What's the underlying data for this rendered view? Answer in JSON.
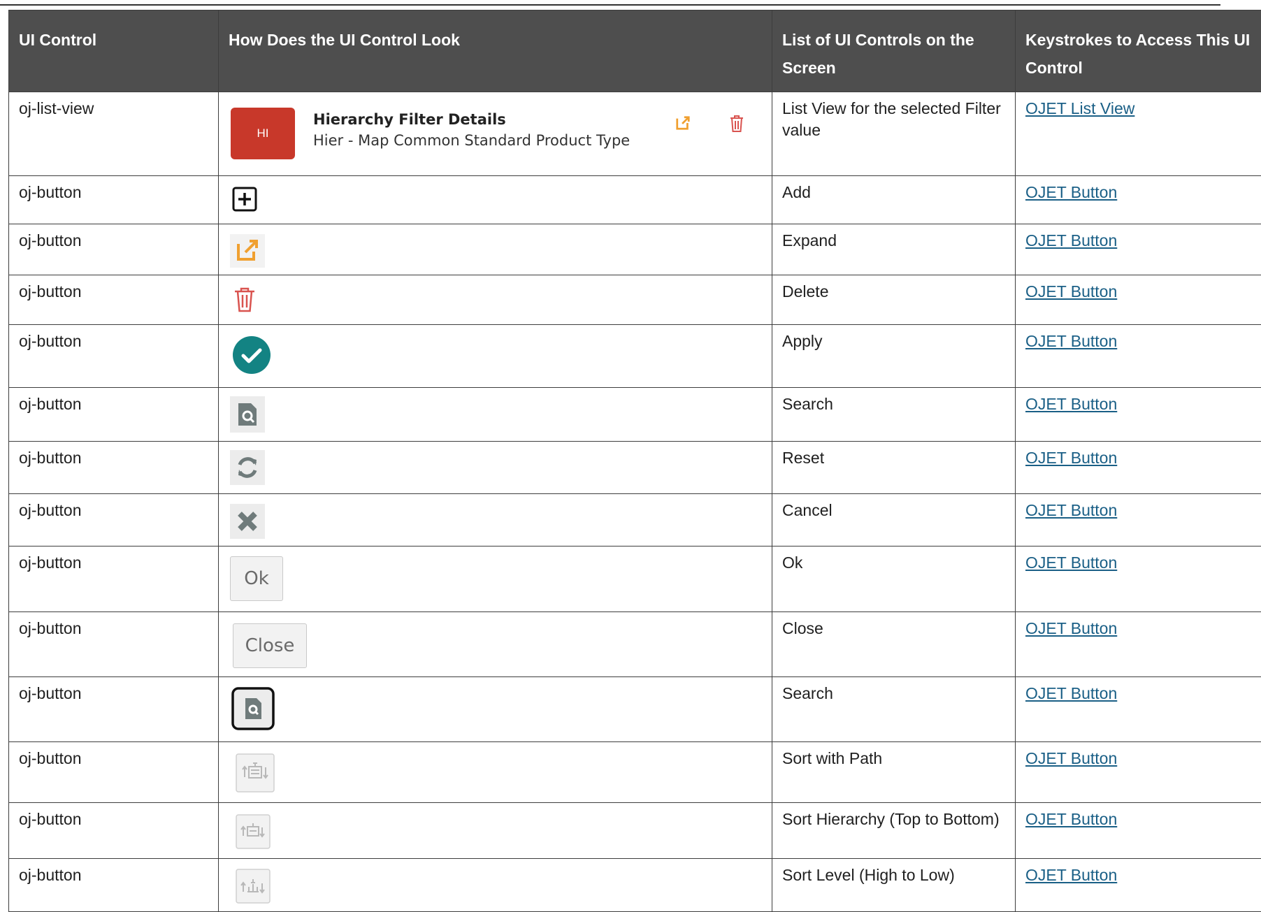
{
  "table": {
    "headers": [
      "UI Control",
      "How Does the UI Control Look",
      "List of UI Controls on the Screen",
      "Keystrokes to Access This UI Control"
    ],
    "list_view": {
      "badge": "HI",
      "title": "Hierarchy Filter Details",
      "subtitle": "Hier - Map Common Standard Product Type"
    },
    "rows": [
      {
        "control": "oj-list-view",
        "icon": "list-view-preview",
        "description": "List View for the selected Filter value",
        "link": "OJET List View"
      },
      {
        "control": "oj-button",
        "icon": "add-icon",
        "description": "Add",
        "link": "OJET Button"
      },
      {
        "control": "oj-button",
        "icon": "expand-icon",
        "description": "Expand",
        "link": "OJET Button"
      },
      {
        "control": "oj-button",
        "icon": "delete-icon",
        "description": "Delete",
        "link": "OJET Button"
      },
      {
        "control": "oj-button",
        "icon": "apply-check-icon",
        "description": "Apply",
        "link": "OJET Button"
      },
      {
        "control": "oj-button",
        "icon": "search-icon",
        "description": "Search",
        "link": "OJET Button"
      },
      {
        "control": "oj-button",
        "icon": "reset-icon",
        "description": "Reset",
        "link": "OJET Button"
      },
      {
        "control": "oj-button",
        "icon": "cancel-icon",
        "description": "Cancel",
        "link": "OJET Button"
      },
      {
        "control": "oj-button",
        "icon": "ok-button",
        "label": "Ok",
        "description": "Ok",
        "link": "OJET Button"
      },
      {
        "control": "oj-button",
        "icon": "close-button",
        "label": "Close",
        "description": "Close",
        "link": "OJET Button"
      },
      {
        "control": "oj-button",
        "icon": "search-focused-icon",
        "description": "Search",
        "link": "OJET Button"
      },
      {
        "control": "oj-button",
        "icon": "sort-path-icon",
        "description": "Sort with Path",
        "link": "OJET Button"
      },
      {
        "control": "oj-button",
        "icon": "sort-hierarchy-icon",
        "description": "Sort Hierarchy (Top to Bottom)",
        "link": "OJET Button"
      },
      {
        "control": "oj-button",
        "icon": "sort-level-icon",
        "description": "Sort Level (High to Low)",
        "link": "OJET Button"
      }
    ]
  },
  "colors": {
    "header_bg": "#4e4e4e",
    "link": "#1a5f86",
    "badge": "#c8382a",
    "expand_orange": "#f0a030",
    "delete_red": "#d9534f",
    "apply_teal": "#138383"
  }
}
